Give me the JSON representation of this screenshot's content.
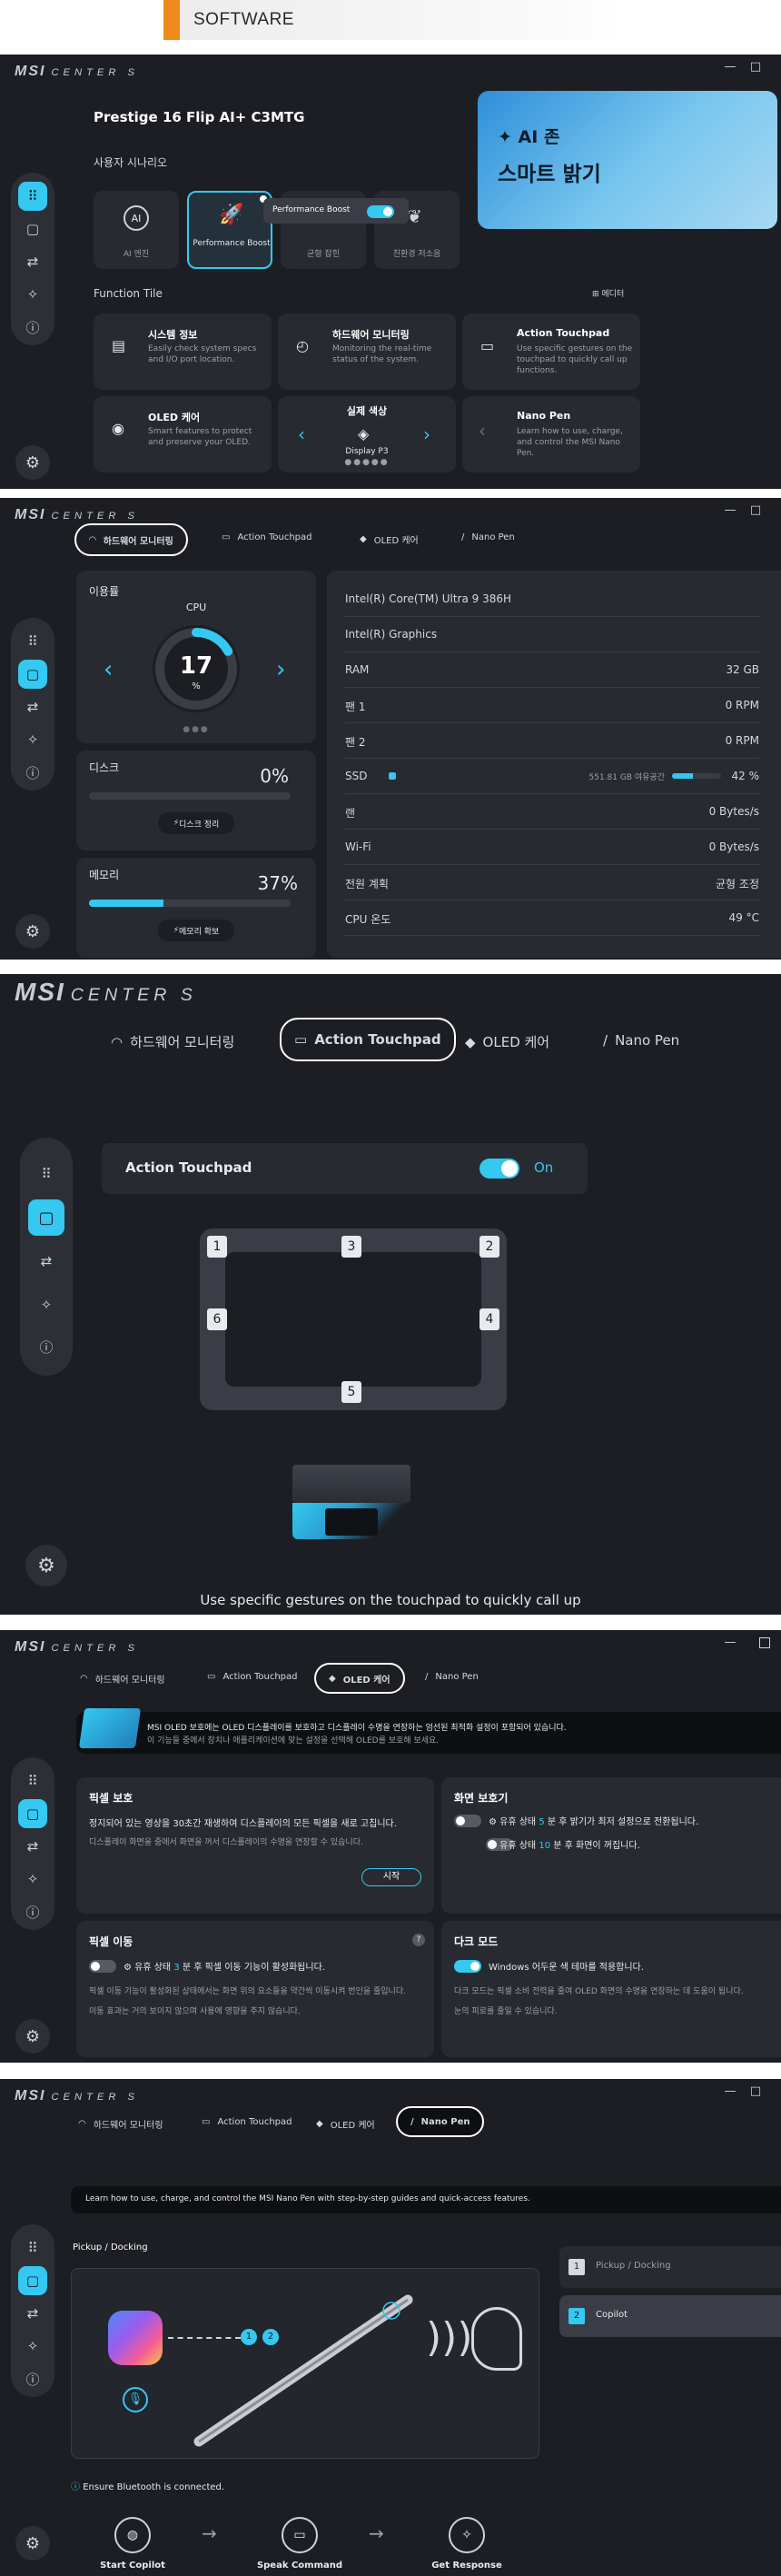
{
  "header": {
    "title": "SOFTWARE"
  },
  "app": {
    "logo_msi": "MSI",
    "logo_center": "CENTER S"
  },
  "window_controls": {
    "minimize": "—",
    "maximize": "□"
  },
  "s1": {
    "device": "Prestige 16 Flip AI+ C3MTG",
    "scenario_label": "사용자 시나리오",
    "scenarios": [
      {
        "label": "AI 엔진",
        "icon": "ai-icon"
      },
      {
        "label": "Performance Boost",
        "icon": "rocket-icon"
      },
      {
        "label": "균형 잡힌",
        "icon": "balance-icon"
      },
      {
        "label": "친환경 저소음",
        "icon": "leaf-icon"
      }
    ],
    "popover": {
      "label": "Performance Boost",
      "on": true
    },
    "banner": {
      "title": "AI 존",
      "subtitle": "스마트 밝기"
    },
    "function_tile": "Function Tile",
    "edit": "에디터",
    "tiles": [
      {
        "title": "시스템 정보",
        "desc": "Easily check system specs and I/O port location."
      },
      {
        "title": "하드웨어 모니터링",
        "desc": "Monitoring the real-time status of the system."
      },
      {
        "title": "Action Touchpad",
        "desc": "Use specific gestures on the touchpad to quickly call up functions."
      },
      {
        "title": "OLED 케어",
        "desc": "Smart features to protect and preserve your OLED."
      },
      {
        "title": "실제 색상",
        "desc": "Display P3"
      },
      {
        "title": "Nano Pen",
        "desc": "Learn how to use, charge, and control the MSI Nano Pen."
      }
    ]
  },
  "tabs": [
    "하드웨어 모니터링",
    "Action Touchpad",
    "OLED 케어",
    "Nano Pen"
  ],
  "s2": {
    "usage": "이용률",
    "cpu": "CPU",
    "cpu_value": "17",
    "cpu_unit": "%",
    "cpu_fraction": 0.17,
    "disk": "디스크",
    "disk_value": "0%",
    "disk_btn": "디스크 정리",
    "disk_fraction": 0,
    "memory": "메모리",
    "memory_value": "37%",
    "memory_btn": "메모리 확보",
    "memory_fraction": 0.37,
    "rows": [
      {
        "label": "Intel(R) Core(TM) Ultra 9 386H",
        "value": ""
      },
      {
        "label": "Intel(R) Graphics",
        "value": ""
      },
      {
        "label": "RAM",
        "value": "32 GB"
      },
      {
        "label": "팬 1",
        "value": "0 RPM"
      },
      {
        "label": "팬 2",
        "value": "0 RPM"
      },
      {
        "label": "SSD",
        "value": "42 %",
        "extra": "551.81 GB 여유공간",
        "fraction": 0.42
      },
      {
        "label": "랜",
        "value": "0 Bytes/s"
      },
      {
        "label": "Wi-Fi",
        "value": "0 Bytes/s"
      },
      {
        "label": "전원 계획",
        "value": "균형 조정"
      },
      {
        "label": "CPU 온도",
        "value": "49 °C"
      }
    ]
  },
  "s3": {
    "toggle_label": "Action Touchpad",
    "toggle_state": "On",
    "zones": [
      "1",
      "2",
      "3",
      "4",
      "5",
      "6"
    ],
    "caption": "Use specific gestures on the touchpad to quickly call up"
  },
  "s4": {
    "banner_line1": "MSI OLED 보호에는 OLED 디스플레이를 보호하고 디스플레이 수명을 연장하는 엄선된 최적화 설정이 포함되어 있습니다.",
    "banner_line2": "이 기능들 중에서 장치나 애플리케이션에 맞는 설정을 선택해 OLED를 보호해 보세요.",
    "pixel_protect": {
      "title": "픽셀 보호",
      "line1": "정지되어 있는 영상을 30초간 재생하여 디스플레이의 모든 픽셀을 새로 고칩니다.",
      "line2": "디스플레이 화면을 중에서 화면을 꺼서 디스플레이의 수명을 연장할 수 있습니다.",
      "btn": "시작"
    },
    "screensaver": {
      "title": "화면 보호기",
      "line1_a": "유휴 상태",
      "line1_n": "5",
      "line1_b": "분 후 밝기가 최저 설정으로 전환됩니다.",
      "line2_a": "유휴 상태",
      "line2_n": "10",
      "line2_b": "분 후 화면이 꺼집니다."
    },
    "pixel_shift": {
      "title": "픽셀 이동",
      "line1_a": "유휴 상태",
      "line1_n": "3",
      "line1_b": "분 후 픽셀 이동 기능이 활성화됩니다.",
      "line2": "픽셀 이동 기능이 활성화된 상태에서는 화면 위의 요소들을 약간씩 이동시켜 번인을 줄입니다.",
      "line3": "이동 효과는 거의 보이지 않으며 사용에 영향을 주지 않습니다."
    },
    "dark_mode": {
      "title": "다크 모드",
      "line1": "Windows 어두운 색 테마를 적용합니다.",
      "line2": "다크 모드는 픽셀 소비 전력을 줄여 OLED 화면의 수명을 연장하는 데 도움이 됩니다.",
      "line3": "눈의 피로를 줄일 수 있습니다."
    }
  },
  "s5": {
    "intro": "Learn how to use, charge, and control the MSI Nano Pen with step-by-step guides and quick-access features.",
    "section": "Pickup / Docking",
    "list": [
      {
        "num": "1",
        "label": "Pickup / Docking"
      },
      {
        "num": "2",
        "label": "Copilot"
      }
    ],
    "bt": "Ensure Bluetooth is connected.",
    "steps": [
      "Start Copilot",
      "Speak Command",
      "Get Response"
    ],
    "callouts": [
      "1",
      "2"
    ]
  }
}
